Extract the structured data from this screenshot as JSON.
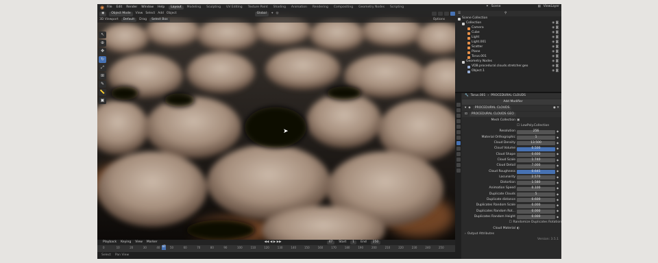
{
  "topbar": {
    "menus": [
      "File",
      "Edit",
      "Render",
      "Window",
      "Help"
    ],
    "workspaces": [
      "Layout",
      "Modeling",
      "Sculpting",
      "UV Editing",
      "Texture Paint",
      "Shading",
      "Animation",
      "Rendering",
      "Compositing",
      "Geometry Nodes",
      "Scripting"
    ],
    "active_workspace": "Layout",
    "scene": "Scene",
    "view_layer": "ViewLayer"
  },
  "viewport": {
    "editor": "3D Viewport",
    "mode": "Object Mode",
    "menus": [
      "View",
      "Select",
      "Add",
      "Object"
    ],
    "orientation": "Global",
    "pivot": "Default",
    "drag": "Drag",
    "select": "Select Box",
    "options": "Options"
  },
  "tools": [
    "cursor-arrow",
    "circle-select",
    "move",
    "rotate",
    "scale",
    "transform",
    "annotate",
    "measure",
    "add-cube"
  ],
  "timeline": {
    "menus": [
      "Playback",
      "Keying",
      "View",
      "Marker"
    ],
    "current_frame": "47",
    "start_label": "Start",
    "start": "1",
    "end_label": "End",
    "end": "250",
    "ticks": [
      "0",
      "10",
      "20",
      "30",
      "40",
      "50",
      "60",
      "70",
      "80",
      "90",
      "100",
      "110",
      "120",
      "130",
      "140",
      "150",
      "160",
      "170",
      "180",
      "190",
      "200",
      "210",
      "220",
      "230",
      "240",
      "250"
    ],
    "footer": [
      "Select",
      "Pan View"
    ]
  },
  "outliner": {
    "title": "Scene Collection",
    "rows": [
      {
        "label": "Collection",
        "color": "#cfcfcf"
      },
      {
        "label": "Camera",
        "color": "#e8914a"
      },
      {
        "label": "Cube",
        "color": "#e8914a"
      },
      {
        "label": "Light",
        "color": "#e8914a"
      },
      {
        "label": "Light.001",
        "color": "#e8914a"
      },
      {
        "label": "Scatter",
        "color": "#e8914a"
      },
      {
        "label": "Plane",
        "color": "#e8914a"
      },
      {
        "label": "Torus.001",
        "color": "#e8914a"
      },
      {
        "label": "Geometry Nodes",
        "color": "#cfcfcf"
      },
      {
        "label": "VDB.procedural.clouds.stretcher.geo",
        "color": "#9ab0d8"
      },
      {
        "label": "Object.1",
        "color": "#9ab0d8"
      }
    ]
  },
  "properties": {
    "object_path": [
      "Torus.001",
      "PROCEDURAL CLOUDS"
    ],
    "add_modifier": "Add Modifier",
    "modifier_name": "PROCEDURAL CLOUDS",
    "node_group": "PROCEDURAL CLOUDS GEO",
    "mesh_collection_label": "Mesh Collection",
    "collection_checkbox": "LowPoly.Collection",
    "fields": [
      {
        "label": "Resolution",
        "value": "256"
      },
      {
        "label": "Material Orthographic",
        "value": "1"
      },
      {
        "label": "Cloud Density",
        "value": "13.500"
      },
      {
        "label": "Cloud Volume",
        "value": "0.500"
      },
      {
        "label": "Cloud Shape",
        "value": "0.600"
      },
      {
        "label": "Cloud Scale",
        "value": "1.740"
      },
      {
        "label": "Cloud Detail",
        "value": "7.000"
      },
      {
        "label": "Cloud Roughness",
        "value": "0.645"
      },
      {
        "label": "Lacunarity",
        "value": "2.570"
      },
      {
        "label": "Distortion",
        "value": "1.580"
      },
      {
        "label": "Animation Speed",
        "value": "0.100"
      },
      {
        "label": "Duplicate Clouds",
        "value": "5"
      },
      {
        "label": "Duplicate distance",
        "value": "0.600"
      },
      {
        "label": "Duplicates Random Scale",
        "value": "0.000"
      },
      {
        "label": "Duplicates Random Rot...",
        "value": "0.000"
      },
      {
        "label": "Duplicates Random Height",
        "value": "0.000"
      }
    ],
    "random_toggle": "Randomize Duplicates Rotation",
    "cloud_material_label": "Cloud Material",
    "output_attributes": "Output Attributes",
    "version": "Version: 3.5.1"
  }
}
